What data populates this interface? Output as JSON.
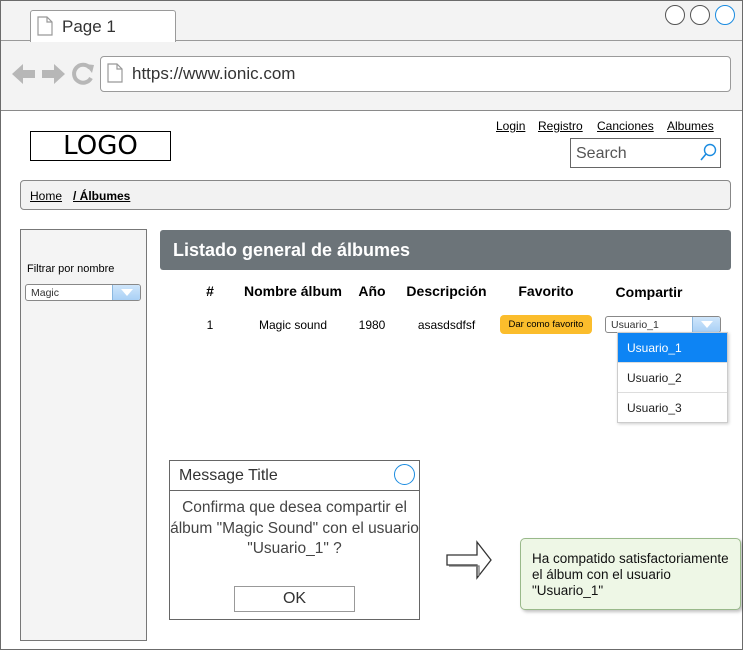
{
  "browser": {
    "tab_title": "Page 1",
    "url": "https://www.ionic.com"
  },
  "site": {
    "logo": "LOGO",
    "nav": [
      "Login",
      "Registro",
      "Canciones",
      "Albumes"
    ],
    "search_placeholder": "Search"
  },
  "breadcrumb": {
    "home": "Home",
    "current": "/ Álbumes"
  },
  "sidebar": {
    "filter_label": "Filtrar por nombre",
    "filter_value": "Magic"
  },
  "main": {
    "title": "Listado general de álbumes",
    "columns": [
      "#",
      "Nombre álbum",
      "Año",
      "Descripción",
      "Favorito",
      "Compartir"
    ],
    "rows": [
      {
        "num": "1",
        "name": "Magic sound",
        "year": "1980",
        "description": "asasdsdfsf",
        "favorite_label": "Dar como favorito",
        "share_value": "Usuario_1"
      }
    ],
    "share_options": [
      "Usuario_1",
      "Usuario_2",
      "Usuario_3"
    ]
  },
  "dialog": {
    "title": "Message Title",
    "message": "Confirma que desea compartir el álbum \"Magic Sound\" con el usuario \"Usuario_1\" ?",
    "ok_label": "OK"
  },
  "notification": {
    "text": "Ha compatido satisfactoriamente el álbum con el usuario \"Usuario_1\""
  },
  "colors": {
    "header_bar": "#6c7479",
    "favorite_button": "#fbbd2c",
    "selected_option": "#0d84f4",
    "notification_bg": "#eef7e6"
  }
}
